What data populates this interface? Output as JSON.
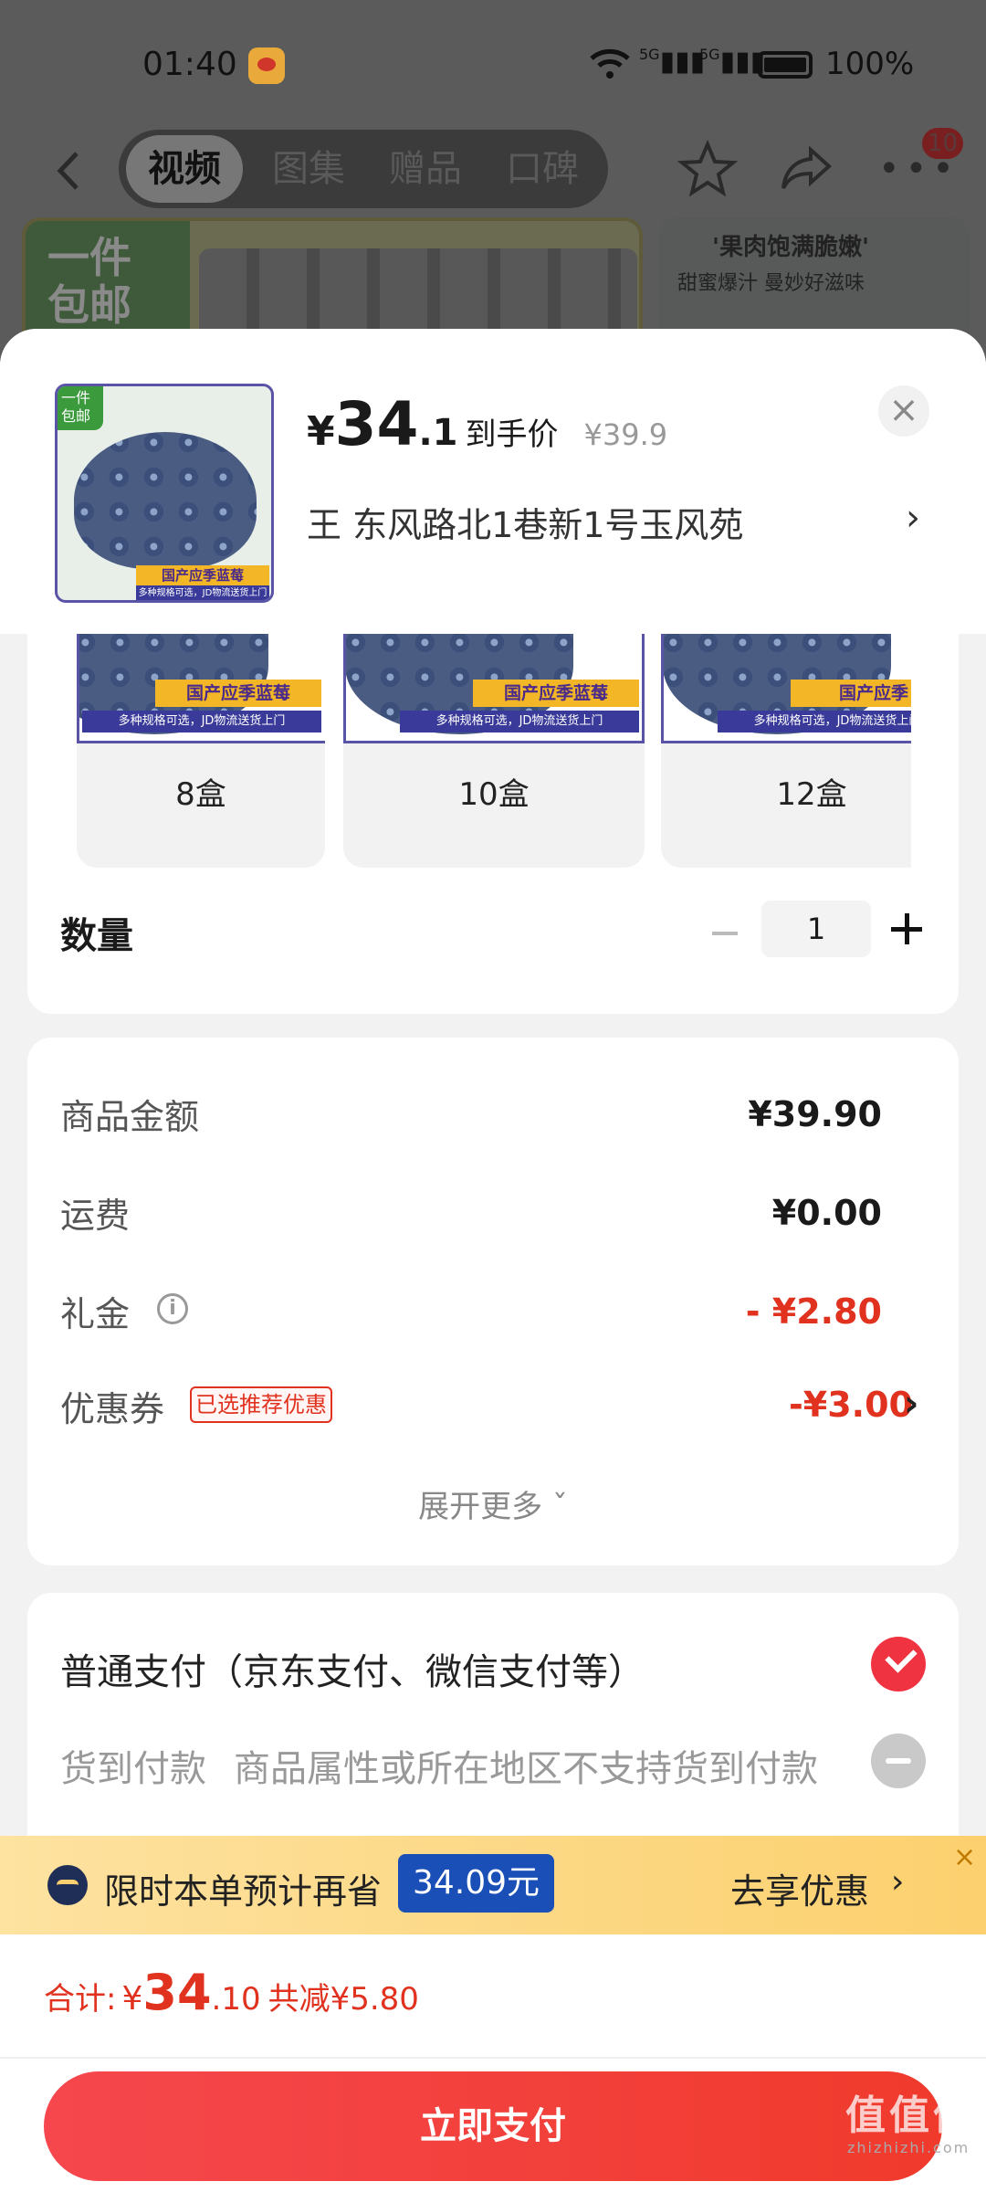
{
  "status_bar": {
    "time": "01:40",
    "signal_1": "5G",
    "signal_2": "5G",
    "battery": "100%"
  },
  "nav": {
    "tabs": [
      {
        "label": "视频",
        "active": true
      },
      {
        "label": "图集",
        "active": false
      },
      {
        "label": "赠品",
        "active": false
      },
      {
        "label": "口碑",
        "active": false
      }
    ],
    "badge": "10",
    "icons": [
      "back-icon",
      "star-icon",
      "share-icon",
      "more-icon"
    ]
  },
  "banners": {
    "left_text": "一件\n包邮",
    "right_text_1": "'果肉饱满脆嫩'",
    "right_text_2": "甜蜜爆汁 曼妙好滋味"
  },
  "product": {
    "thumb_tag": "一件\n包邮",
    "thumb_label": "国产应季蓝莓",
    "thumb_sub": "多种规格可选，JD物流送货上门",
    "price_symbol": "¥",
    "price_int": "34",
    "price_dec": ".1",
    "price_label": "到手价",
    "price_original": "¥39.9",
    "address": "王  东风路北1巷新1号玉风苑"
  },
  "specs": [
    {
      "name": "8盒",
      "label": "国产应季蓝莓",
      "sub": "多种规格可选，JD物流送货上门"
    },
    {
      "name": "10盒",
      "label": "国产应季蓝莓",
      "sub": "多种规格可选，JD物流送货上门"
    },
    {
      "name": "12盒",
      "label": "国产应季",
      "sub": "多种规格可选，JD物流送货上门"
    }
  ],
  "quantity": {
    "label": "数量",
    "value": "1"
  },
  "fees": {
    "goods_label": "商品金额",
    "goods_value": "¥39.90",
    "shipping_label": "运费",
    "shipping_value": "¥0.00",
    "gift_label": "礼金",
    "gift_value": "- ¥2.80",
    "coupon_label": "优惠券",
    "coupon_tag": "已选推荐优惠",
    "coupon_value": "-¥3.00",
    "expand_label": "展开更多 ˇ"
  },
  "payment": {
    "normal_label": "普通支付（京东支付、微信支付等）",
    "cod_label": "货到付款",
    "cod_desc": "商品属性或所在地区不支持货到付款"
  },
  "promo": {
    "text": "限时本单预计再省",
    "amount": "34.09元",
    "go_label": "去享优惠",
    "close": "×"
  },
  "footer": {
    "total_label": "合计:",
    "total_symbol": "¥",
    "total_int": "34",
    "total_dec": ".10",
    "total_saved": "共减¥5.80",
    "pay_button": "立即支付",
    "watermark": "值值值",
    "watermark_url": "zhizhizhi.com"
  },
  "colors": {
    "accent_red": "#e0321f",
    "pay_button": "#f2403c",
    "promo_blue": "#1a4fb8"
  }
}
